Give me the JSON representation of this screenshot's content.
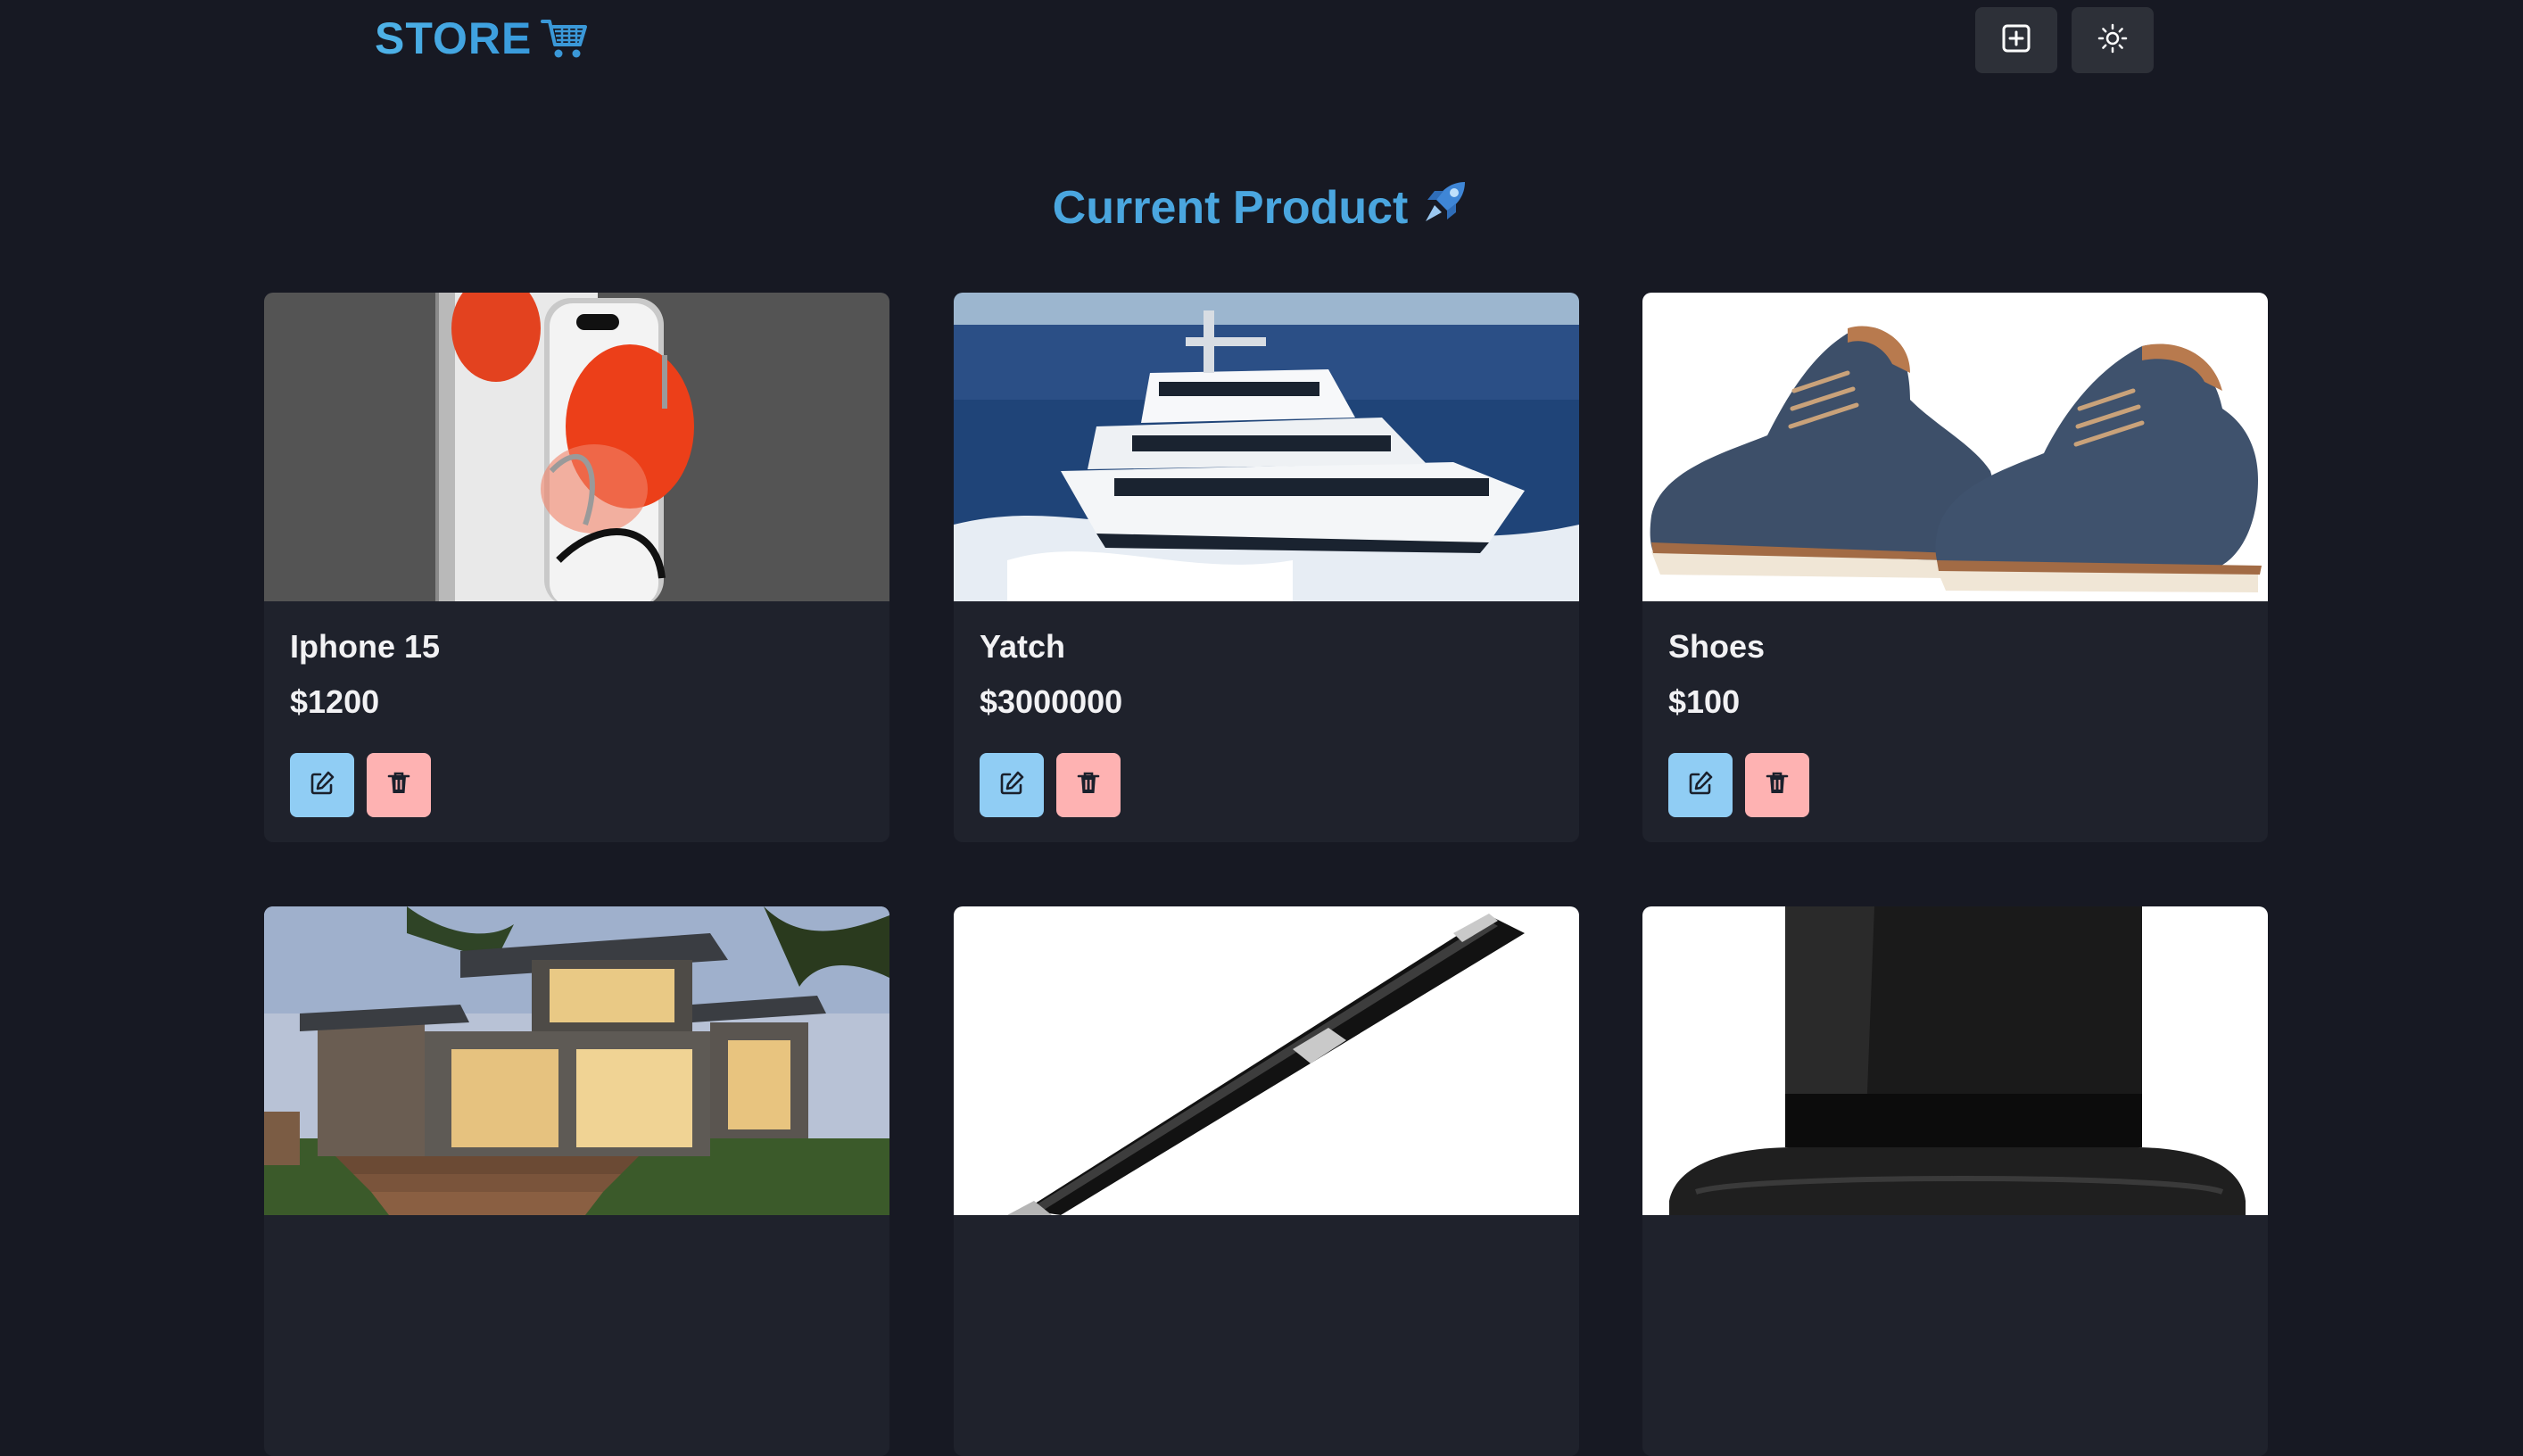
{
  "navbar": {
    "brand": "STORE",
    "brand_icon": "shopping-cart-icon",
    "add_icon": "plus-square-icon",
    "theme_icon": "sun-icon"
  },
  "main": {
    "heading": "Current Product",
    "heading_icon": "rocket-icon"
  },
  "products": [
    {
      "name": "Iphone 15",
      "price": "$1200",
      "image": "iphone-image"
    },
    {
      "name": "Yatch",
      "price": "$3000000",
      "image": "yacht-image"
    },
    {
      "name": "Shoes",
      "price": "$100",
      "image": "shoes-image"
    },
    {
      "name": "",
      "price": "",
      "image": "house-image"
    },
    {
      "name": "",
      "price": "",
      "image": "pen-image"
    },
    {
      "name": "",
      "price": "",
      "image": "top-hat-image"
    }
  ],
  "colors": {
    "background": "#171923",
    "card": "#1f222c",
    "accent": "#4aa6df",
    "edit_button": "#90cdf4",
    "delete_button": "#feb2b2"
  }
}
